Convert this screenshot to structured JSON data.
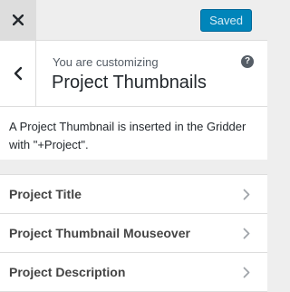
{
  "topbar": {
    "close_icon": "close-icon",
    "saved_label": "Saved"
  },
  "header": {
    "back_icon": "chevron-left-icon",
    "customizing_label": "You are customizing",
    "section_title": "Project Thumbnails",
    "help_glyph": "?"
  },
  "description": "A Project Thumbnail is inserted in the Gridder with \"+Project\".",
  "items": [
    {
      "label": "Project Title",
      "icon": "chevron-right-icon"
    },
    {
      "label": "Project Thumbnail Mouseover",
      "icon": "chevron-right-icon"
    },
    {
      "label": "Project Description",
      "icon": "chevron-right-icon"
    }
  ],
  "colors": {
    "accent": "#0085ba",
    "panel_bg": "#eeeeee",
    "card_bg": "#ffffff"
  }
}
